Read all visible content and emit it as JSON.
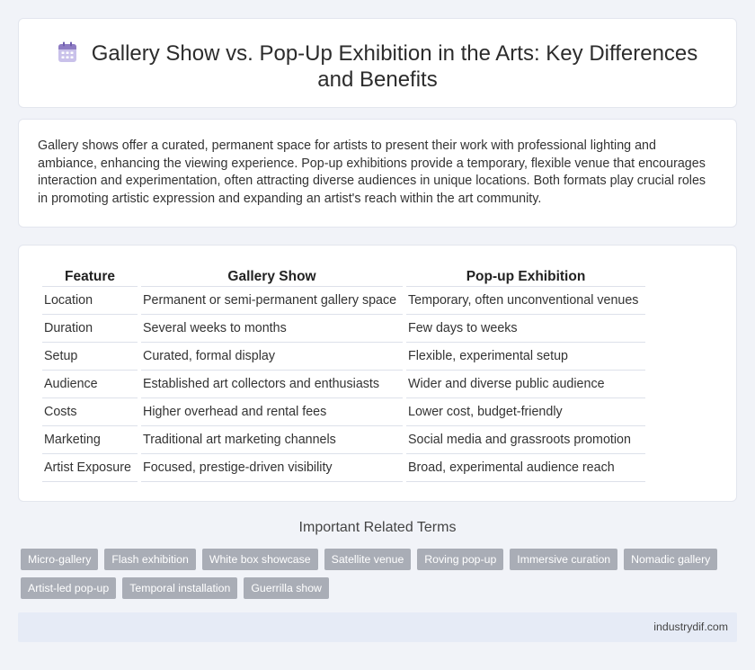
{
  "header": {
    "icon": "calendar-icon",
    "title": "Gallery Show vs. Pop-Up Exhibition in the Arts: Key Differences and Benefits"
  },
  "intro": {
    "text": "Gallery shows offer a curated, permanent space for artists to present their work with professional lighting and ambiance, enhancing the viewing experience. Pop-up exhibitions provide a temporary, flexible venue that encourages interaction and experimentation, often attracting diverse audiences in unique locations. Both formats play crucial roles in promoting artistic expression and expanding an artist's reach within the art community."
  },
  "table": {
    "headers": [
      "Feature",
      "Gallery Show",
      "Pop-up Exhibition"
    ],
    "rows": [
      [
        "Location",
        "Permanent or semi-permanent gallery space",
        "Temporary, often unconventional venues"
      ],
      [
        "Duration",
        "Several weeks to months",
        "Few days to weeks"
      ],
      [
        "Setup",
        "Curated, formal display",
        "Flexible, experimental setup"
      ],
      [
        "Audience",
        "Established art collectors and enthusiasts",
        "Wider and diverse public audience"
      ],
      [
        "Costs",
        "Higher overhead and rental fees",
        "Lower cost, budget-friendly"
      ],
      [
        "Marketing",
        "Traditional art marketing channels",
        "Social media and grassroots promotion"
      ],
      [
        "Artist Exposure",
        "Focused, prestige-driven visibility",
        "Broad, experimental audience reach"
      ]
    ]
  },
  "related": {
    "title": "Important Related Terms",
    "tags": [
      "Micro-gallery",
      "Flash exhibition",
      "White box showcase",
      "Satellite venue",
      "Roving pop-up",
      "Immersive curation",
      "Nomadic gallery",
      "Artist-led pop-up",
      "Temporal installation",
      "Guerrilla show"
    ]
  },
  "footer": {
    "site": "industrydif.com"
  },
  "colors": {
    "background": "#f1f3f8",
    "tag": "#a9adb6",
    "footer": "#e6ebf6",
    "icon_accent": "#8e7cc3"
  }
}
